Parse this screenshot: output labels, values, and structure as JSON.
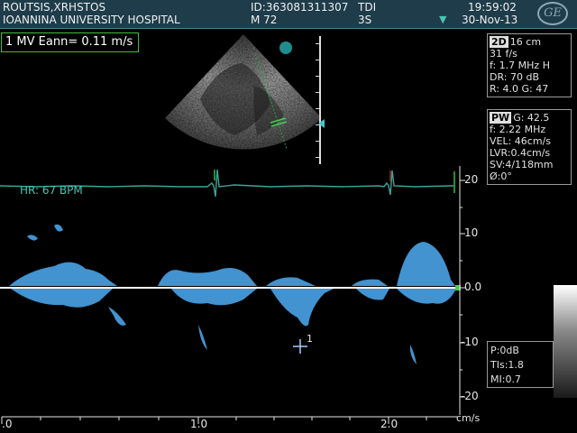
{
  "header": {
    "patient_name": "ROUTSIS,XRHSTOS",
    "hospital": "IOANNINA UNIVERSITY HOSPITAL",
    "patient_id": "ID:363081311307",
    "patient_info": "M 72",
    "mode": "TDI",
    "probe": "3S",
    "time": "19:59:02",
    "date": "30-Nov-13",
    "logo_text": "GE"
  },
  "measurement": {
    "index": "1",
    "label": "MV Eann=",
    "value": "0.11 m/s"
  },
  "params_2d": {
    "tag": "2D",
    "lines": [
      "16 cm",
      "31 f/s",
      "f: 1.7 MHz H",
      "DR: 70 dB",
      "R: 4.0   G: 47"
    ]
  },
  "params_pw": {
    "tag": "PW",
    "lines": [
      "G: 42.5",
      "f: 2.22 MHz",
      "VEL: 46cm/s",
      "LVR:0.4cm/s",
      "SV:4/118mm",
      "Ø:0°"
    ]
  },
  "safety": {
    "p": "P:0dB",
    "tis": "TIs:1.8",
    "mi": "MI:0.7"
  },
  "ecg": {
    "hr_label": "HR: 67 BPM"
  },
  "velocity_scale": {
    "labels": [
      "20",
      "10",
      "0.0",
      "-10",
      "-20"
    ],
    "unit": "cm/s"
  },
  "time_scale": {
    "labels": [
      ".0",
      "1.0",
      "2.0"
    ]
  },
  "cursor_marker": {
    "index": "1"
  },
  "colors": {
    "header_bg": "#1e3c4a",
    "ecg": "#3aa597",
    "doppler": "#4aa3e6",
    "baseline": "#ffffff",
    "measure_box": "#3fbf3f",
    "cursor": "#9fd0ff"
  }
}
